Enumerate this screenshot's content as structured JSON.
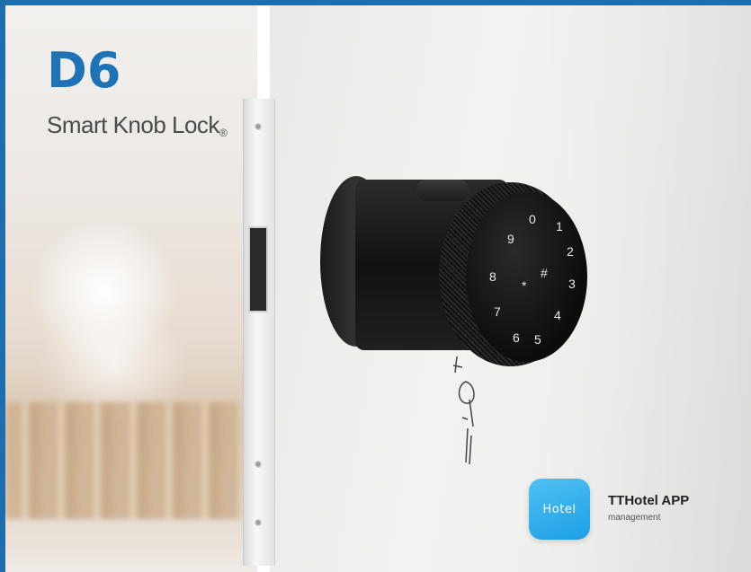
{
  "product": {
    "model": "D6",
    "name": "Smart Knob Lock",
    "registered_mark": "®"
  },
  "keypad": {
    "keys": [
      "0",
      "1",
      "2",
      "3",
      "4",
      "5",
      "6",
      "7",
      "8",
      "9",
      "*",
      "#"
    ]
  },
  "app": {
    "icon_text": "Hotel",
    "name": "TTHotel APP",
    "subtitle": "management"
  },
  "colors": {
    "brand_blue": "#1e73b6",
    "app_icon": "#2aa9ec"
  },
  "icons": [
    "tthotel-app-icon",
    "fingerprint-sensor-icon"
  ]
}
